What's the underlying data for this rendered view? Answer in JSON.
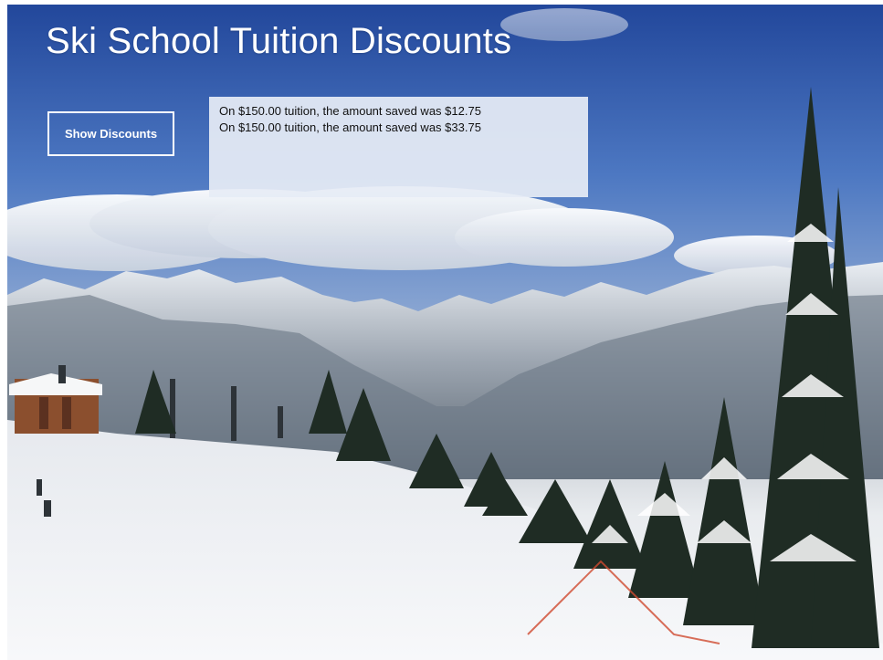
{
  "app": {
    "title": "Ski School Tuition Discounts"
  },
  "actions": {
    "show_discounts_label": "Show Discounts"
  },
  "results": {
    "lines": [
      "On $150.00 tuition, the amount saved was $12.75",
      "On $150.00 tuition, the amount saved was $33.75"
    ]
  },
  "background": {
    "icon": "mountain-ski-scene",
    "sky": "#2f5fb4",
    "snow": "#f4f5f7",
    "trees": "#1f2c24"
  }
}
